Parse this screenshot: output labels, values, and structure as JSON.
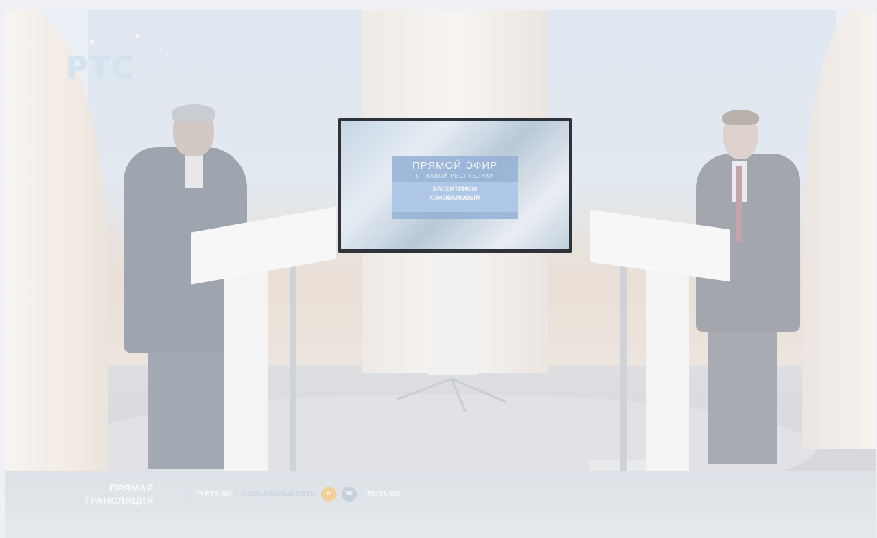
{
  "video": {
    "channel_logo_text": "РТС",
    "tv_screen": {
      "title": "ПРЯМОЙ ЭФИР",
      "subtitle": "С ГЛАВОЙ РЕСПУБЛИКИ",
      "name_line1": "ВАЛЕНТИНОМ",
      "name_line2": "КОНОВАЛОВЫМ"
    }
  },
  "lower_bar": {
    "live_label_line1": "ПРЯМАЯ",
    "live_label_line2": "ТРАНСЛЯЦИЯ",
    "separator": "/",
    "site_link": "TVRTS.RU",
    "social_label": "СОЦИАЛЬНЫЕ СЕТИ",
    "ok_icon_glyph": "ö",
    "vk_icon_glyph": "VK",
    "rutube_label": "RUTUBE"
  },
  "colors": {
    "ok_brand": "#f3cf9b",
    "vk_brand": "#c7cfd8",
    "bar_bg": "#dde2e7"
  }
}
